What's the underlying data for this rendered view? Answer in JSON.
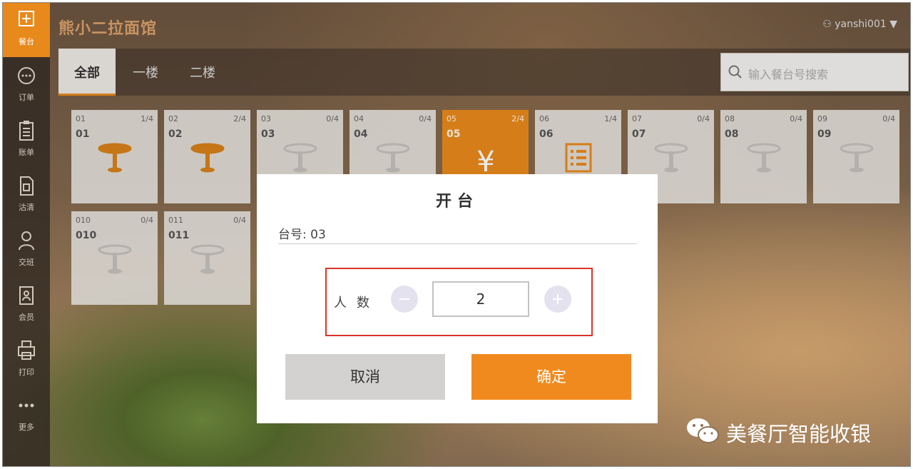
{
  "sidebar": {
    "items": [
      {
        "label": "餐台",
        "icon": "plus-square-icon",
        "active": true
      },
      {
        "label": "订单",
        "icon": "chat-bubble-icon",
        "active": false
      },
      {
        "label": "账单",
        "icon": "clipboard-icon",
        "active": false
      },
      {
        "label": "沽清",
        "icon": "document-icon",
        "active": false
      },
      {
        "label": "交班",
        "icon": "person-icon",
        "active": false
      },
      {
        "label": "会员",
        "icon": "member-card-icon",
        "active": false
      },
      {
        "label": "打印",
        "icon": "printer-icon",
        "active": false
      },
      {
        "label": "更多",
        "icon": "more-dots-icon",
        "active": false
      }
    ]
  },
  "header": {
    "title": "熊小二拉面馆",
    "user": "yanshi001"
  },
  "tabs": [
    {
      "label": "全部",
      "active": true
    },
    {
      "label": "一楼",
      "active": false
    },
    {
      "label": "二楼",
      "active": false
    }
  ],
  "search": {
    "placeholder": "输入餐台号搜索"
  },
  "tables": [
    {
      "code": "01",
      "name": "01",
      "count": "1/4",
      "state": "occupied"
    },
    {
      "code": "02",
      "name": "02",
      "count": "2/4",
      "state": "occupied"
    },
    {
      "code": "03",
      "name": "03",
      "count": "0/4",
      "state": "empty"
    },
    {
      "code": "04",
      "name": "04",
      "count": "0/4",
      "state": "empty"
    },
    {
      "code": "05",
      "name": "05",
      "count": "2/4",
      "state": "billing"
    },
    {
      "code": "06",
      "name": "06",
      "count": "1/4",
      "state": "ordered"
    },
    {
      "code": "07",
      "name": "07",
      "count": "0/4",
      "state": "empty"
    },
    {
      "code": "08",
      "name": "08",
      "count": "0/4",
      "state": "empty"
    },
    {
      "code": "09",
      "name": "09",
      "count": "0/4",
      "state": "empty"
    },
    {
      "code": "010",
      "name": "010",
      "count": "0/4",
      "state": "empty"
    },
    {
      "code": "011",
      "name": "011",
      "count": "0/4",
      "state": "empty"
    }
  ],
  "dialog": {
    "title": "开台",
    "table_no": "台号: 03",
    "guests_label": "人数",
    "guests_value": "2",
    "cancel_label": "取消",
    "confirm_label": "确定"
  },
  "watermark": {
    "text": "美餐厅智能收银"
  },
  "colors": {
    "accent": "#e8891c",
    "confirm": "#f08a1e",
    "highlight_border": "#d9342b"
  }
}
